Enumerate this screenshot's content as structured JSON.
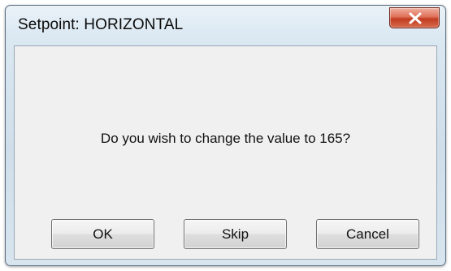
{
  "window": {
    "title": "Setpoint: HORIZONTAL",
    "close_icon": "close-x-icon",
    "close_button_color": "#c23c22"
  },
  "dialog": {
    "message": "Do you wish to change the value to 165?"
  },
  "buttons": {
    "ok_label": "OK",
    "skip_label": "Skip",
    "cancel_label": "Cancel"
  }
}
